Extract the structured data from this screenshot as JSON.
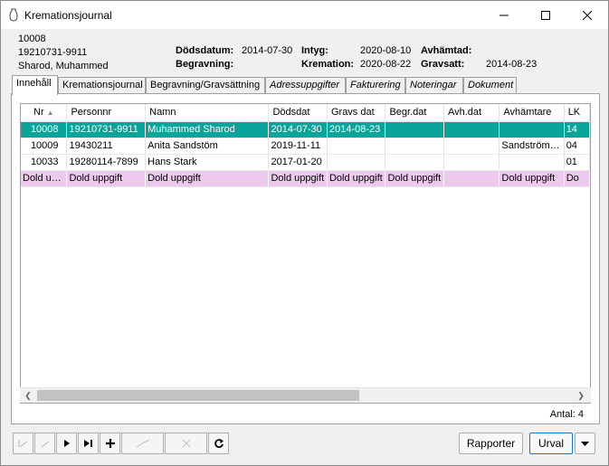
{
  "window": {
    "title": "Kremationsjournal"
  },
  "record": {
    "nr": "10008",
    "personnr": "19210731-9911",
    "name": "Sharod, Muhammed",
    "dodsdatum_label": "Dödsdatum:",
    "dodsdatum": "2014-07-30",
    "begravning_label": "Begravning:",
    "begravning": "",
    "intyg_label": "Intyg:",
    "intyg": "2020-08-10",
    "kremation_label": "Kremation:",
    "kremation": "2020-08-22",
    "avhamtad_label": "Avhämtad:",
    "avhamtad": "",
    "gravsatt_label": "Gravsatt:",
    "gravsatt": "2014-08-23"
  },
  "tabs": [
    {
      "label": "Innehåll",
      "italic": false,
      "active": true
    },
    {
      "label": "Kremationsjournal",
      "italic": false,
      "active": false
    },
    {
      "label": "Begravning/Gravsättning",
      "italic": false,
      "active": false
    },
    {
      "label": "Adressuppgifter",
      "italic": true,
      "active": false
    },
    {
      "label": "Fakturering",
      "italic": true,
      "active": false
    },
    {
      "label": "Noteringar",
      "italic": true,
      "active": false
    },
    {
      "label": "Dokument",
      "italic": true,
      "active": false
    }
  ],
  "grid": {
    "columns": [
      "Nr",
      "Personnr",
      "Namn",
      "Dödsdat",
      "Gravs dat",
      "Begr.dat",
      "Avh.dat",
      "Avhämtare",
      "LK"
    ],
    "sort_indicator": "▲",
    "rows": [
      {
        "type": "selected",
        "cells": [
          "10008",
          "19210731-9911",
          "Muhammed Sharod",
          "2014-07-30",
          "2014-08-23",
          "",
          "",
          "",
          "14"
        ]
      },
      {
        "type": "normal",
        "cells": [
          "10009",
          "19430211",
          "Anita Sandstöm",
          "2019-11-11",
          "",
          "",
          "",
          "Sandström…",
          "04"
        ]
      },
      {
        "type": "normal",
        "cells": [
          "10033",
          "19280114-7899",
          "Hans Stark",
          "2017-01-20",
          "",
          "",
          "",
          "",
          "01"
        ]
      },
      {
        "type": "hidden",
        "cells": [
          "Dold u…",
          "Dold uppgift",
          "Dold uppgift",
          "Dold uppgift",
          "Dold uppgift",
          "Dold uppgift",
          "",
          "Dold uppgift",
          "Do"
        ]
      }
    ]
  },
  "footer": {
    "antal": "Antal: 4",
    "rapporter_label": "Rapporter",
    "urval_label": "Urval"
  },
  "colors": {
    "selected_row": "#0aa59a",
    "hidden_row": "#eec9ee",
    "default_button_border": "#0a78d7"
  },
  "icons": [
    "app-urn-icon",
    "minimize-icon",
    "maximize-icon",
    "close-icon",
    "first-record-icon",
    "previous-record-icon",
    "next-record-icon",
    "last-record-icon",
    "add-record-icon",
    "edit-record-icon",
    "delete-record-icon",
    "refresh-icon",
    "dropdown-arrow-icon",
    "sort-asc-icon",
    "scroll-left-icon",
    "scroll-right-icon"
  ]
}
